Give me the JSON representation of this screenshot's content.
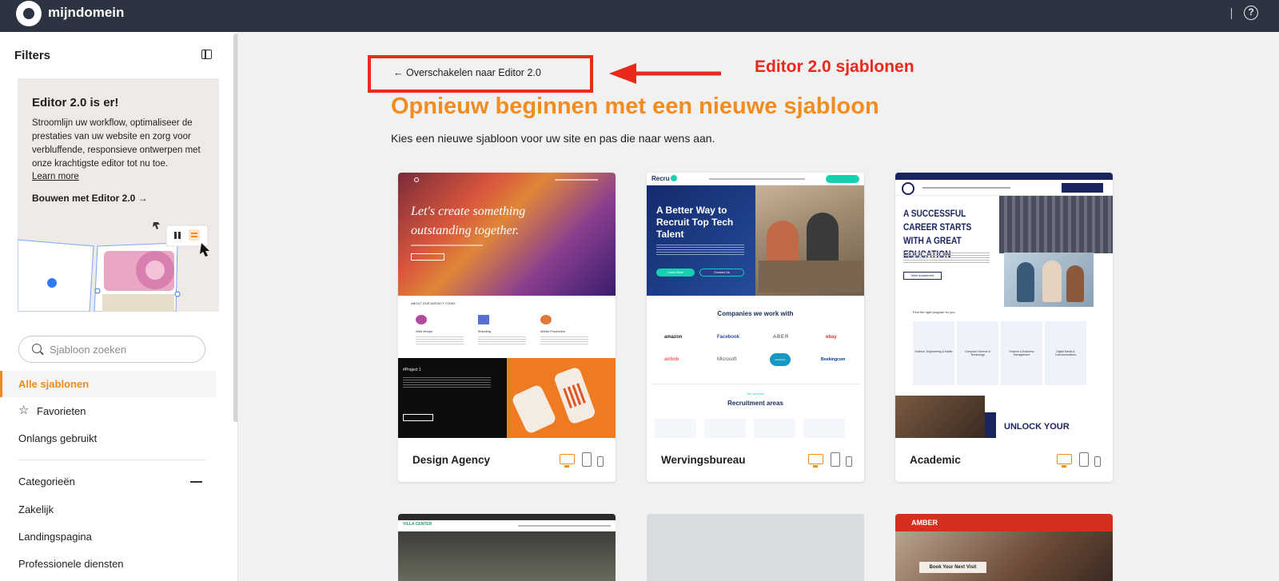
{
  "app": {
    "brand": "mijndomein",
    "help_label": "?"
  },
  "sidebar": {
    "filters_title": "Filters",
    "promo": {
      "title": "Editor 2.0 is er!",
      "text": "Stroomlijn uw workflow, optimaliseer de prestaties van uw website en zorg voor verbluffende, responsieve ontwerpen met onze krachtigste editor tot nu toe.",
      "learn_more": "Learn more",
      "build": "Bouwen met Editor 2.0 →"
    },
    "search": {
      "placeholder": "Sjabloon zoeken"
    },
    "nav": [
      {
        "label": "Alle sjablonen"
      },
      {
        "label": "Favorieten"
      },
      {
        "label": "Onlangs gebruikt"
      }
    ],
    "categories_title": "Categorieën",
    "categories": [
      {
        "label": "Zakelijk"
      },
      {
        "label": "Landingspagina"
      },
      {
        "label": "Professionele diensten"
      }
    ]
  },
  "main": {
    "switch_link": "←  Overschakelen naar Editor 2.0",
    "annotation": "Editor 2.0 sjablonen",
    "title": "Opnieuw beginnen met een nieuwe sjabloon",
    "subtitle": "Kies een nieuwe sjabloon voor uw site en pas die naar wens aan.",
    "templates": [
      {
        "name": "Design Agency",
        "preview": {
          "hero_line1": "Let's create something",
          "hero_line2": "outstanding together.",
          "section_label": "ABOUT OUR AGENCY TODAY",
          "services": [
            "Web design",
            "Branding",
            "Media Production"
          ],
          "project_label": "#Project 1"
        }
      },
      {
        "name": "Wervingsbureau",
        "preview": {
          "logo": "Recru",
          "hero": "A Better Way to Recruit Top Tech Talent",
          "cta_primary": "Learn More",
          "cta_secondary": "Contact Us",
          "companies_title": "Companies we work with",
          "companies": [
            "amazon",
            "Facebook",
            "ABER",
            "ebay",
            "airbnb",
            "Microsoft",
            "salesforce",
            "Bookingcom"
          ],
          "services_label": "Our services",
          "areas_title": "Recruitment areas"
        }
      },
      {
        "name": "Academic",
        "preview": {
          "hero": "A SUCCESSFUL CAREER STARTS WITH A GREAT EDUCATION",
          "cta": "View Academics",
          "program_label": "Find the right program for you",
          "programs": [
            "Science, Engineering & Maths",
            "Computer Science & Technology",
            "Finance & Business Management",
            "Digital Media & Communications"
          ],
          "banner": "UNLOCK YOUR"
        }
      }
    ],
    "second_row": [
      {
        "label": "VILLA CENTER"
      },
      {
        "label": ""
      },
      {
        "label": "AMBER",
        "cta": "Book Your Next Visit"
      }
    ]
  },
  "colors": {
    "accent": "#f28c1e",
    "annotation": "#e8291c",
    "topbar": "#2b3440"
  }
}
